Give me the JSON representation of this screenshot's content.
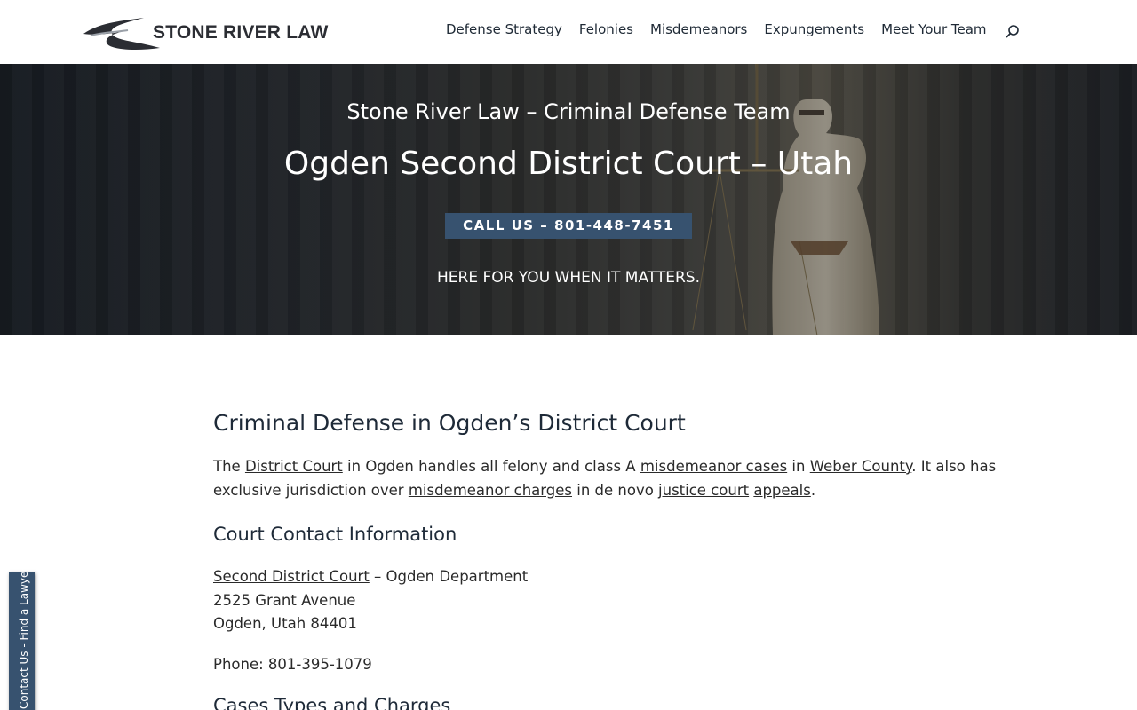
{
  "header": {
    "logo_text": "STONE RIVER LAW",
    "nav": [
      "Defense Strategy",
      "Felonies",
      "Misdemeanors",
      "Expungements",
      "Meet Your Team"
    ]
  },
  "hero": {
    "subtitle": "Stone River Law – Criminal Defense Team",
    "title": "Ogden Second District Court – Utah",
    "cta": "CALL US – 801-448-7451",
    "tagline": "HERE FOR YOU WHEN IT MATTERS."
  },
  "content": {
    "heading1": "Criminal Defense in Ogden’s District Court",
    "para1": {
      "t1": "The ",
      "link1": "District Court",
      "t2": " in Ogden handles all felony and class A ",
      "link2": "misdemeanor cases",
      "t3": " in ",
      "link3": "Weber County",
      "t4": ". It also has",
      "t5": "exclusive jurisdiction over ",
      "link4": "misdemeanor charges",
      "t6": " in de novo ",
      "link5": "justice court",
      "t7": " ",
      "link6": "appeals",
      "t8": "."
    },
    "heading2": "Court Contact Information",
    "address": {
      "link": "Second District Court",
      "dept": " – Ogden Department",
      "street": "2525 Grant Avenue",
      "city": "Ogden, Utah 84401"
    },
    "phone": "Phone: 801-395-1079",
    "heading3": "Cases Types and Charges"
  },
  "side_tab": "Contact Us - Find a Lawyer",
  "colors": {
    "accent": "#37526f",
    "heading": "#1e2a38"
  }
}
